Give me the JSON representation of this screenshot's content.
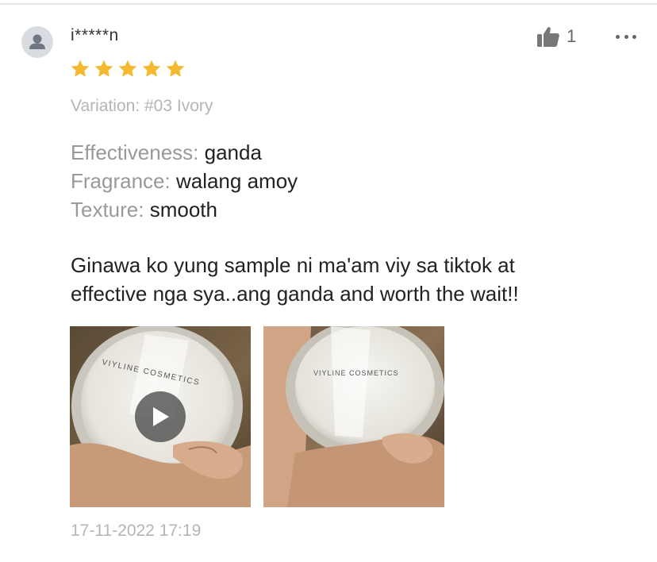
{
  "review": {
    "username": "i*****n",
    "rating": 5,
    "like_count": "1",
    "variation": "Variation: #03 Ivory",
    "attributes": [
      {
        "label": "Effectiveness: ",
        "value": "ganda"
      },
      {
        "label": "Fragrance: ",
        "value": "walang amoy"
      },
      {
        "label": "Texture: ",
        "value": "smooth"
      }
    ],
    "comment_line1": "Ginawa ko yung sample ni ma'am viy sa tiktok at",
    "comment_line2": "effective nga sya..ang ganda and worth the wait!!",
    "media": [
      {
        "type": "video",
        "brand_text": "VIYLINE COSMETICS"
      },
      {
        "type": "image",
        "brand_text": "VIYLINE COSMETICS"
      }
    ],
    "timestamp": "17-11-2022 17:19"
  },
  "colors": {
    "star": "#f5b82e",
    "muted_text": "#b5b5b5",
    "label_text": "#999999",
    "body_text": "#222222"
  },
  "icons": {
    "avatar": "person-icon",
    "like": "thumbs-up-icon",
    "more": "more-dots-icon",
    "play": "play-icon"
  }
}
